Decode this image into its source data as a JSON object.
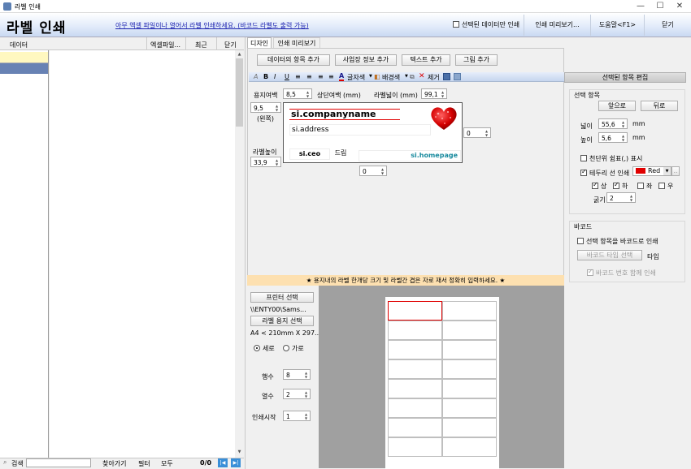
{
  "window": {
    "title": "라벨 인쇄",
    "minimize": "—",
    "maximize": "☐",
    "close": "✕"
  },
  "header": {
    "app_title": "라벨 인쇄",
    "note": "아무 엑셀 파일이나 열어서 라벨 인쇄하세요. (바코드 라벨도 출력 가능)",
    "selected_only": "선택된 데이터만 인쇄",
    "print_preview": "인쇄 미리보기...",
    "help": "도움말<F1>",
    "close": "닫기"
  },
  "data_panel": {
    "label": "데이터",
    "excel_file": "엑셀파일...",
    "recent": "최근",
    "close": "닫기",
    "search_label": "검색",
    "find": "찾아가기",
    "filter": "필터",
    "all": "모두",
    "count": "0/0"
  },
  "tabs": [
    {
      "label": "디자인"
    },
    {
      "label": "인쇄 미리보기"
    }
  ],
  "design": {
    "add_data_item": "데이터의 항목 추가",
    "add_business_info": "사업장 정보 추가",
    "add_text": "텍스트 추가",
    "add_picture": "그림 추가",
    "toolbar": {
      "font_color": "글자색",
      "bg_color": "배경색",
      "delete": "제거"
    },
    "paper_margin_label": "용지여백",
    "paper_margin_value": "8,5",
    "top_margin_label": "상단여백 (mm)",
    "left_margin_value": "9,5",
    "left_label": "(왼쪽)",
    "label_width_label": "라벨넓이 (mm)",
    "label_width_value": "99,1",
    "label_height_label": "라벨높이",
    "label_height_value": "33,9",
    "right_gap_value": "0",
    "bottom_gap_value": "0",
    "label_fields": {
      "company": "si.companyname",
      "address": "si.address",
      "ceo": "si.ceo",
      "greeting": "드림",
      "homepage": "si.homepage"
    }
  },
  "selected_item_panel": {
    "title": "선택된 항목 편집",
    "group_label": "선택 항목",
    "bring_front": "앞으로",
    "send_back": "뒤로",
    "width_label": "넓이",
    "width_value": "55,6",
    "height_label": "높이",
    "height_value": "5,6",
    "unit": "mm",
    "thousand_sep": "천단위 쉼표(,) 표시",
    "border_print": "테두리 선 인쇄",
    "border_color": "Red",
    "sides": {
      "top": "상",
      "bottom": "하",
      "left": "좌",
      "right": "우"
    },
    "thickness_label": "굵기",
    "thickness_value": "2"
  },
  "barcode_panel": {
    "group_label": "바코드",
    "print_as_barcode": "선택 항목을 바코드로 인쇄",
    "select_type": "바코드 타입 선택",
    "type_label": "타입",
    "print_number": "바코드 번호 함께 인쇄"
  },
  "instruction": "★ 용지내의 라벨 한개당 크기 및 라벨간 겹은 자로 재서 정확히 입력하세요. ★",
  "print_settings": {
    "printer_select": "프린터 선택",
    "printer_name": "\\\\ENTY00\\Sams...",
    "paper_select": "라벨 용지 선택",
    "paper_name": "A4 < 210mm X 297...",
    "portrait": "세로",
    "landscape": "가로",
    "rows_label": "행수",
    "rows_value": "8",
    "cols_label": "열수",
    "cols_value": "2",
    "start_label": "인쇄시작",
    "start_value": "1"
  },
  "colors": {
    "accent_red": "#e00000",
    "header_blue": "#c9d9f2",
    "selection_blue": "#6882b4",
    "teal": "#188a9e"
  }
}
